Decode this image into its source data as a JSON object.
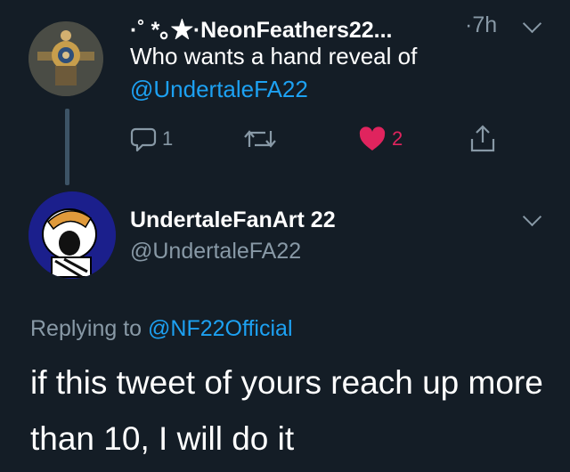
{
  "tweet": {
    "display_name": "·˚ *｡★·NeonFeathers22...",
    "time": "·7h",
    "text_line1": "Who wants a hand reveal of",
    "mention": "@UndertaleFA22",
    "reply_count": "1",
    "like_count": "2"
  },
  "reply_tweet": {
    "display_name": "UndertaleFanArt 22",
    "handle": "@UndertaleFA22",
    "replying_label": "Replying to",
    "replying_to": "@NF22Official",
    "text": "if this tweet of yours reach up more than 10, I will do it"
  },
  "colors": {
    "background": "#141d26",
    "secondary_text": "#8899a6",
    "link": "#1da1f2",
    "like": "#e0245e"
  },
  "icons": [
    "reply-icon",
    "retweet-icon",
    "heart-icon",
    "share-icon",
    "chevron-down-icon"
  ]
}
